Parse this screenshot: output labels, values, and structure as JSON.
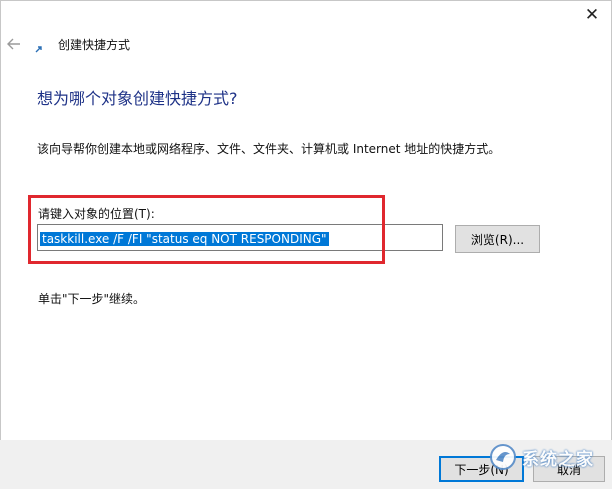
{
  "window": {
    "title": "创建快捷方式",
    "close_icon": "close-icon",
    "back_icon": "back-arrow-icon"
  },
  "page": {
    "heading": "想为哪个对象创建快捷方式?",
    "description": "该向导帮你创建本地或网络程序、文件、文件夹、计算机或 Internet 地址的快捷方式。",
    "field_label": "请键入对象的位置(T):",
    "path_value": "taskkill.exe /F /FI \"status eq NOT RESPONDING\"",
    "browse_label": "浏览(R)...",
    "hint": "单击\"下一步\"继续。"
  },
  "footer": {
    "next_label": "下一步(N)",
    "cancel_label": "取消"
  },
  "watermark": {
    "text": "系统之家"
  },
  "colors": {
    "heading": "#1e3287",
    "selection": "#0078d7",
    "highlight_box": "#e0282e",
    "footer_bg": "#f0f0f0"
  }
}
